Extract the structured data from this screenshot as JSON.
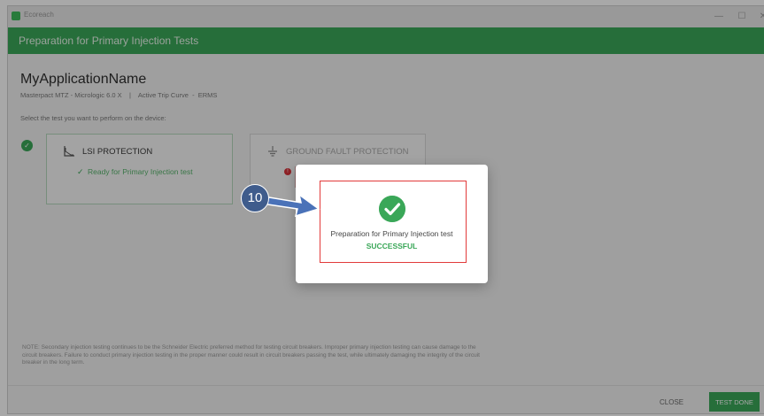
{
  "window": {
    "app_name": "Ecoreach"
  },
  "header": {
    "title": "Preparation for Primary Injection Tests"
  },
  "main": {
    "title": "MyApplicationName",
    "subtitle": "Masterpact MTZ - Micrologic 6.0 X    |    Active Trip Curve  -  ERMS",
    "prompt": "Select the test you want to perform on the device:"
  },
  "cards": [
    {
      "title": "LSI PROTECTION",
      "status": "Ready for Primary Injection test"
    },
    {
      "title": "GROUND FAULT PROTECTION"
    }
  ],
  "note": "NOTE: Secondary injection testing continues to be the Schneider Electric preferred method for testing circuit breakers. Improper primary injection testing can cause damage to the circuit breakers. Failure to conduct primary injection testing in the proper manner could result in circuit breakers passing the test, while ultimately damaging the integrity of the circuit breaker in the long term.",
  "footer": {
    "close_label": "CLOSE",
    "test_done_label": "TEST DONE"
  },
  "dialog": {
    "message": "Preparation for Primary Injection test",
    "status": "SUCCESSFUL"
  },
  "callout": {
    "number": "10"
  },
  "colors": {
    "accent_green": "#3aa758",
    "highlight_red": "#e23a3a",
    "callout_blue": "#3f5c8c"
  }
}
